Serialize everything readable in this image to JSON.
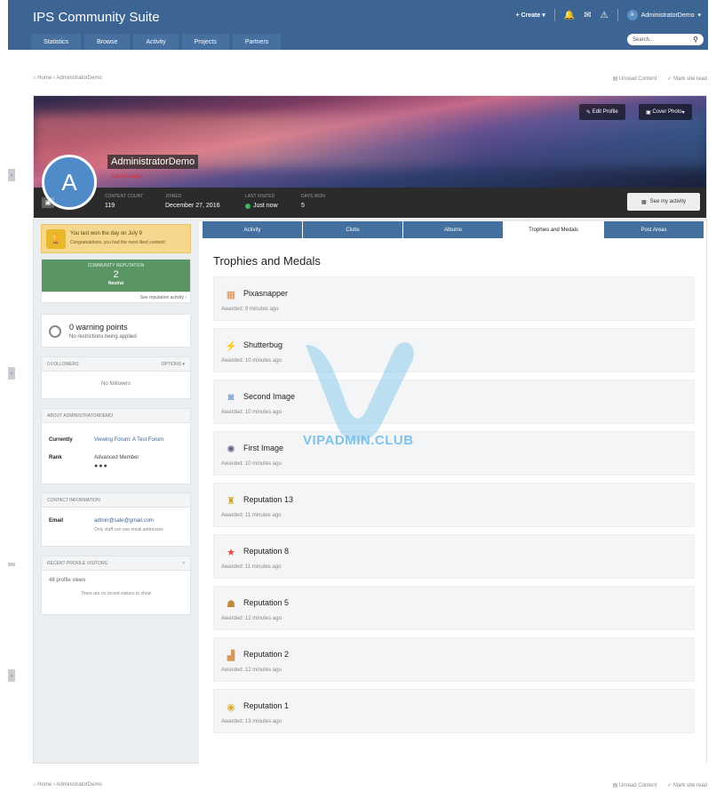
{
  "header": {
    "app_title": "IPS Community Suite",
    "nav": [
      "Statistics",
      "Browse",
      "Activity",
      "Projects",
      "Partners"
    ],
    "create_label": "Create",
    "user_initial": "A",
    "user_name": "AdministratorDemo",
    "search_placeholder": "Search..."
  },
  "breadcrumb": {
    "home": "Home",
    "current": "AdministratorDemo",
    "unread": "Unread Content",
    "mark_read": "Mark site read"
  },
  "profile": {
    "edit_profile": "Edit Profile",
    "cover_photo": "Cover Photo",
    "avatar_initial": "A",
    "username": "AdministratorDemo",
    "usergroup": "Administrator",
    "stats": [
      {
        "label": "Content Count",
        "value": "119"
      },
      {
        "label": "Joined",
        "value": "December 27, 2016"
      },
      {
        "label": "Last Visited",
        "value": "Just now"
      },
      {
        "label": "Days Won",
        "value": "5"
      }
    ],
    "see_activity": "See my activity"
  },
  "sidebar": {
    "winner_title": "You last won the day on July 9",
    "winner_text": "Congratulations, you had the most liked content!",
    "rep_label": "Community Reputation",
    "rep_value": "2",
    "rep_level": "Neutral",
    "rep_link": "See reputation activity",
    "warning_title": "0 warning points",
    "warning_text": "No restrictions being applied",
    "followers_head": "0 Followers",
    "followers_options": "Options",
    "followers_empty": "No followers",
    "about_head": "About AdministratorDemo",
    "about_rows": [
      {
        "label": "Currently",
        "value": "Viewing Forum: A Test Forum"
      },
      {
        "label": "Rank",
        "value": "Advanced Member"
      }
    ],
    "contact_head": "Contact Information",
    "email_label": "Email",
    "email_value": "admin@sale@gmail.com",
    "email_note": "Only staff can see email addresses",
    "visitors_head": "Recent Profile Visitors",
    "profile_views": "48 profile views",
    "visitors_empty": "There are no recent visitors to show"
  },
  "tabs": [
    "Activity",
    "Clubs",
    "Albums",
    "Trophies and Medals",
    "Post Areas"
  ],
  "active_tab": 3,
  "section_title": "Trophies and Medals",
  "trophies": [
    {
      "name": "Pixasnapper",
      "date": "Awarded: 9 minutes ago",
      "icon": "photo-icon"
    },
    {
      "name": "Shutterbug",
      "date": "Awarded: 10 minutes ago",
      "icon": "lightning-icon"
    },
    {
      "name": "Second Image",
      "date": "Awarded: 10 minutes ago",
      "icon": "camera-icon"
    },
    {
      "name": "First Image",
      "date": "Awarded: 10 minutes ago",
      "icon": "aperture-icon"
    },
    {
      "name": "Reputation 13",
      "date": "Awarded: 11 minutes ago",
      "icon": "trophy-cup-icon"
    },
    {
      "name": "Reputation 8",
      "date": "Awarded: 11 minutes ago",
      "icon": "star-icon"
    },
    {
      "name": "Reputation 5",
      "date": "Awarded: 12 minutes ago",
      "icon": "medal-icon"
    },
    {
      "name": "Reputation 2",
      "date": "Awarded: 12 minutes ago",
      "icon": "podium-icon"
    },
    {
      "name": "Reputation 1",
      "date": "Awarded: 13 minutes ago",
      "icon": "gold-medal-icon"
    }
  ],
  "watermark": "VIPADMIN.CLUB"
}
